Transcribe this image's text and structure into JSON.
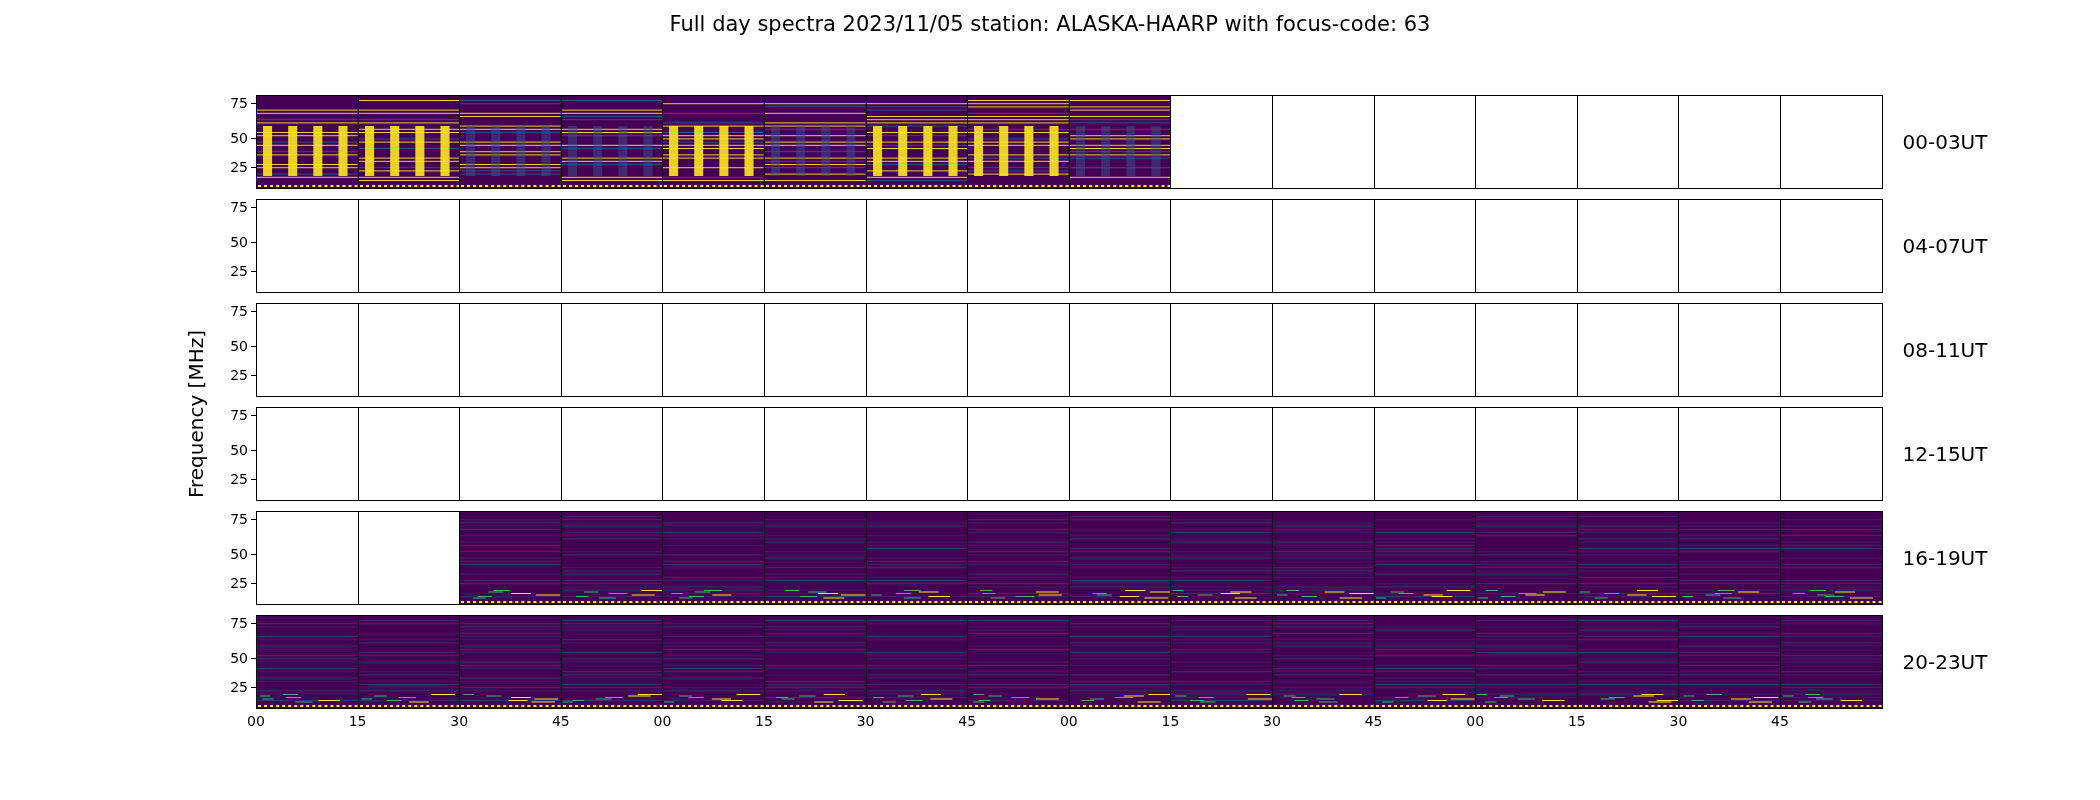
{
  "title": "Full day spectra 2023/11/05 station: ALASKA-HAARP with focus-code: 63",
  "ylabel": "Frequency [MHz]",
  "xticks": [
    "00",
    "15",
    "30",
    "45",
    "00",
    "15",
    "30",
    "45",
    "00",
    "15",
    "30",
    "45",
    "00",
    "15",
    "30",
    "45"
  ],
  "rows": [
    {
      "label": "00-03UT",
      "yticks": [
        "75",
        "50",
        "25"
      ],
      "panels": [
        true,
        true,
        true,
        true,
        true,
        true,
        true,
        true,
        true,
        false,
        false,
        false,
        false,
        false,
        false,
        false
      ]
    },
    {
      "label": "04-07UT",
      "yticks": [
        "75",
        "50",
        "25"
      ],
      "panels": [
        false,
        false,
        false,
        false,
        false,
        false,
        false,
        false,
        false,
        false,
        false,
        false,
        false,
        false,
        false,
        false
      ]
    },
    {
      "label": "08-11UT",
      "yticks": [
        "75",
        "50",
        "25"
      ],
      "panels": [
        false,
        false,
        false,
        false,
        false,
        false,
        false,
        false,
        false,
        false,
        false,
        false,
        false,
        false,
        false,
        false
      ]
    },
    {
      "label": "12-15UT",
      "yticks": [
        "75",
        "50",
        "25"
      ],
      "panels": [
        false,
        false,
        false,
        false,
        false,
        false,
        false,
        false,
        false,
        false,
        false,
        false,
        false,
        false,
        false,
        false
      ]
    },
    {
      "label": "16-19UT",
      "yticks": [
        "75",
        "50",
        "25"
      ],
      "panels": [
        false,
        false,
        true,
        true,
        true,
        true,
        true,
        true,
        true,
        true,
        true,
        true,
        true,
        true,
        true,
        true
      ]
    },
    {
      "label": "20-23UT",
      "yticks": [
        "75",
        "50",
        "25"
      ],
      "panels": [
        true,
        true,
        true,
        true,
        true,
        true,
        true,
        true,
        true,
        true,
        true,
        true,
        true,
        true,
        true,
        true
      ]
    }
  ]
}
